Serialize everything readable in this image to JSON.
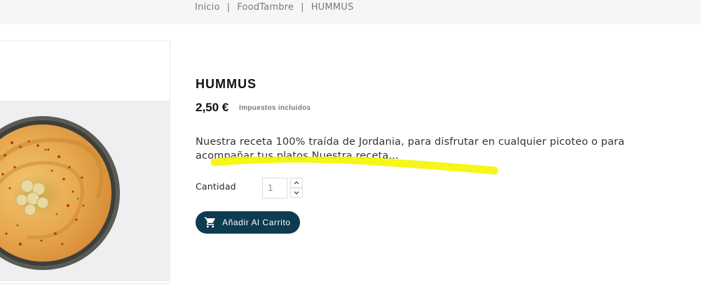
{
  "breadcrumb": {
    "items": [
      "Inicio",
      "FoodTambre",
      "HUMMUS"
    ],
    "separator": "|"
  },
  "product": {
    "title": "HUMMUS",
    "price": "2,50 €",
    "tax_note": "Impuestos incluidos",
    "description": "Nuestra receta 100% traída de Jordania, para disfrutar en cualquier picoteo o para acompañar tus platos.Nuestra receta...",
    "image_icon": "hummus-bowl-photo"
  },
  "quantity": {
    "label": "Cantidad",
    "value": "1",
    "up_icon": "chevron-up-icon",
    "down_icon": "chevron-down-icon"
  },
  "cart_button": {
    "label": "Añadir Al Carrito",
    "icon": "shopping-cart-icon"
  },
  "colors": {
    "button_bg": "#0d3b4f",
    "highlight": "#f5f500"
  }
}
